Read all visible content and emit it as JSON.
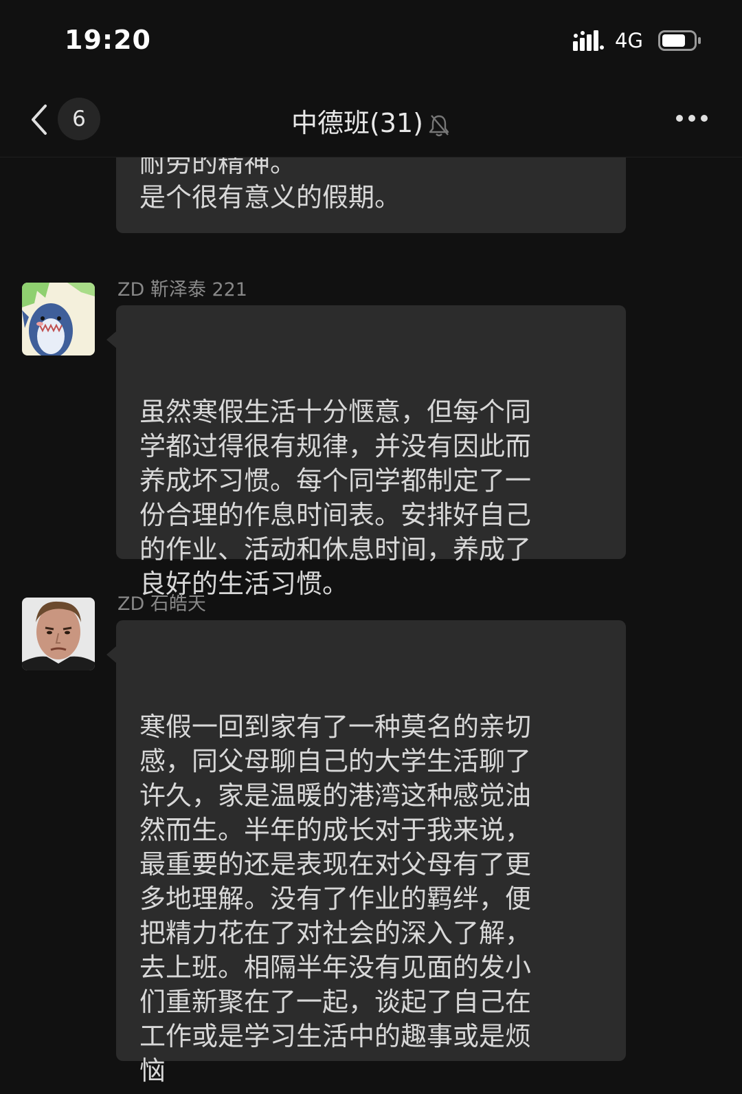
{
  "status_bar": {
    "time": "19:20",
    "network": "4G",
    "battery_level": 0.75
  },
  "nav": {
    "unread_count": "6",
    "title": "中德班(31)"
  },
  "messages": [
    {
      "text": "耐劳的精神。\n是个很有意义的假期。"
    },
    {
      "sender": "ZD 靳泽泰 221",
      "avatar": "cartoon-shark-avatar",
      "text": "虽然寒假生活十分惬意，但每个同\n学都过得很有规律，并没有因此而\n养成坏习惯。每个同学都制定了一\n份合理的作息时间表。安排好自己\n的作业、活动和休息时间，养成了\n良好的生活习惯。"
    },
    {
      "sender": "ZD 石皓天",
      "avatar": "man-photo-avatar",
      "text": "寒假一回到家有了一种莫名的亲切\n感，同父母聊自己的大学生活聊了\n许久，家是温暖的港湾这种感觉油\n然而生。半年的成长对于我来说，\n最重要的还是表现在对父母有了更\n多地理解。没有了作业的羁绊，便\n把精力花在了对社会的深入了解，\n去上班。相隔半年没有见面的发小\n们重新聚在了一起，谈起了自己在\n工作或是学习生活中的趣事或是烦\n恼"
    }
  ]
}
